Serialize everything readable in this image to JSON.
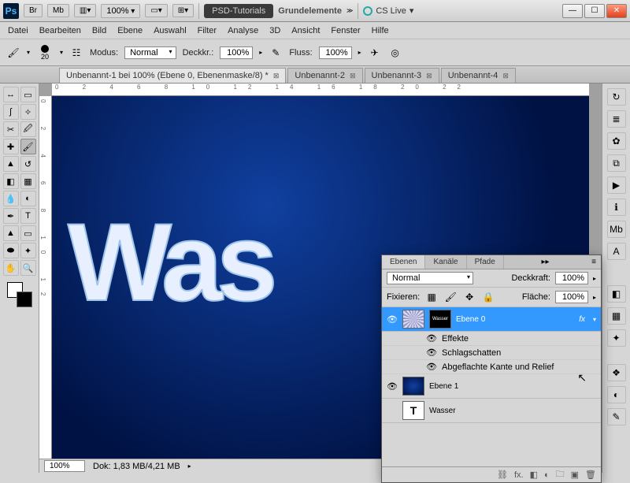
{
  "titlebar": {
    "br": "Br",
    "mb": "Mb",
    "zoom": "100%",
    "psd_tutorials": "PSD-Tutorials",
    "project": "Grundelemente",
    "cslive": "CS Live"
  },
  "menu": [
    "Datei",
    "Bearbeiten",
    "Bild",
    "Ebene",
    "Auswahl",
    "Filter",
    "Analyse",
    "3D",
    "Ansicht",
    "Fenster",
    "Hilfe"
  ],
  "options": {
    "brush_size": "20",
    "modus_label": "Modus:",
    "modus_value": "Normal",
    "deckkr_label": "Deckkr.:",
    "deckkr_value": "100%",
    "fluss_label": "Fluss:",
    "fluss_value": "100%"
  },
  "tabs": [
    {
      "label": "Unbenannt-1 bei 100% (Ebene 0, Ebenenmaske/8) *",
      "active": true
    },
    {
      "label": "Unbenannt-2",
      "active": false
    },
    {
      "label": "Unbenannt-3",
      "active": false
    },
    {
      "label": "Unbenannt-4",
      "active": false
    }
  ],
  "canvas_text": "Was",
  "status": {
    "zoom": "100%",
    "doc": "Dok: 1,83 MB/4,21 MB"
  },
  "layers_panel": {
    "tabs": [
      "Ebenen",
      "Kanäle",
      "Pfade"
    ],
    "blend_mode": "Normal",
    "deckkraft_label": "Deckkraft:",
    "deckkraft_value": "100%",
    "fixieren_label": "Fixieren:",
    "flaeche_label": "Fläche:",
    "flaeche_value": "100%",
    "layers": [
      {
        "name": "Ebene 0",
        "selected": true,
        "fx": true
      },
      {
        "name": "Ebene 1",
        "selected": false
      },
      {
        "name": "Wasser",
        "selected": false,
        "type": "text"
      }
    ],
    "effects_label": "Effekte",
    "effect_items": [
      "Schlagschatten",
      "Abgeflachte Kante und Relief"
    ]
  }
}
